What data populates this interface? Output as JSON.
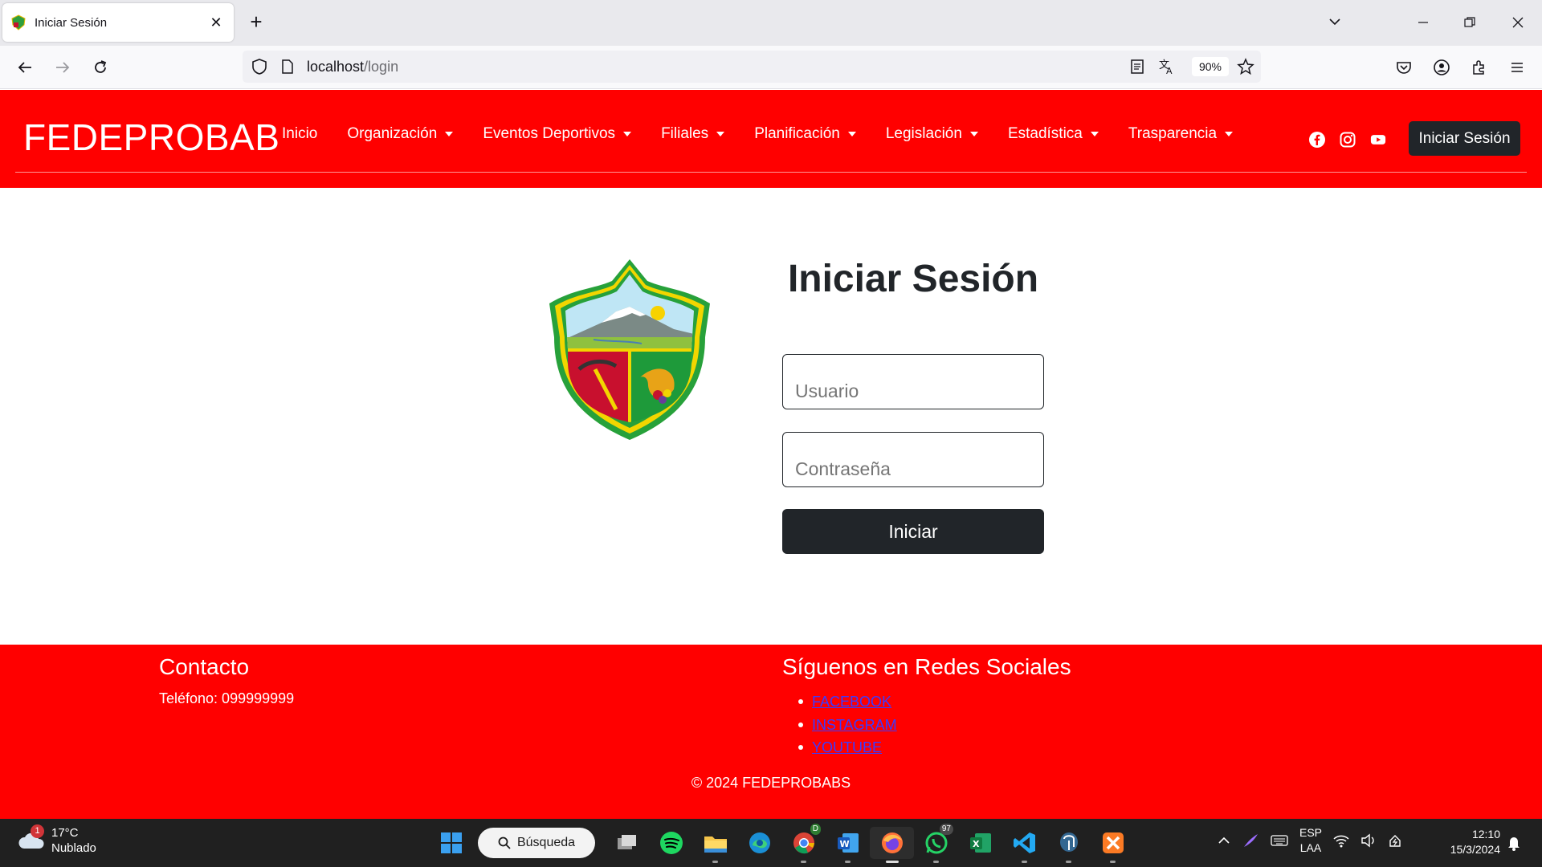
{
  "browser": {
    "tab_title": "Iniciar Sesión",
    "url_host": "localhost",
    "url_path": "/login",
    "zoom": "90%"
  },
  "site": {
    "brand": "FEDEPROBAB",
    "menu": [
      {
        "label": "Inicio",
        "dropdown": false
      },
      {
        "label": "Organización",
        "dropdown": true
      },
      {
        "label": "Eventos Deportivos",
        "dropdown": true
      },
      {
        "label": "Filiales",
        "dropdown": true
      },
      {
        "label": "Planificación",
        "dropdown": true
      },
      {
        "label": "Legislación",
        "dropdown": true
      },
      {
        "label": "Estadística",
        "dropdown": true
      },
      {
        "label": "Trasparencia",
        "dropdown": true
      }
    ],
    "header_login_label": "Iniciar Sesión",
    "accent_color": "#ff0000",
    "dark_color": "#212529"
  },
  "login": {
    "title": "Iniciar Sesión",
    "username_placeholder": "Usuario",
    "password_placeholder": "Contraseña",
    "submit_label": "Iniciar"
  },
  "footer": {
    "contact_title": "Contacto",
    "phone": "Teléfono: 099999999",
    "social_title": "Síguenos en Redes Sociales",
    "social_links": [
      "FACEBOOK",
      "INSTAGRAM",
      "YOUTUBE"
    ],
    "copyright": "© 2024 FEDEPROBABS"
  },
  "taskbar": {
    "temperature": "17°C",
    "weather": "Nublado",
    "weather_badge": "1",
    "search_label": "Búsqueda",
    "whatsapp_badge": "97",
    "chrome_badge": "D",
    "language_1": "ESP",
    "language_2": "LAA",
    "time": "12:10",
    "date": "15/3/2024"
  }
}
